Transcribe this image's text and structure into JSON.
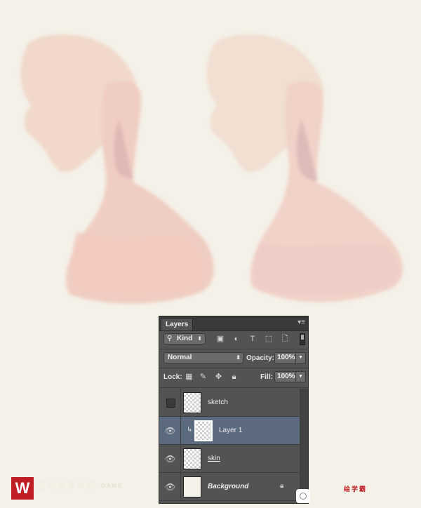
{
  "panel": {
    "tab_label": "Layers",
    "menu_icon": "panel-menu-icon",
    "filter": {
      "kind_label": "Kind"
    },
    "blend_mode": "Normal",
    "opacity_label": "Opacity:",
    "opacity_value": "100%",
    "lock_label": "Lock:",
    "fill_label": "Fill:",
    "fill_value": "100%",
    "layers": [
      {
        "name": "sketch",
        "visible": false,
        "selected": false
      },
      {
        "name": "Layer 1",
        "visible": true,
        "selected": true,
        "clipped": true
      },
      {
        "name": "skin",
        "visible": true,
        "selected": false
      },
      {
        "name": "Background",
        "visible": true,
        "selected": false,
        "locked": true
      }
    ]
  },
  "watermark": {
    "brand_cn": "王氏教育集团",
    "brand_game": "GAME",
    "brand_sub": "游戏手绘专修学院",
    "right_top": "国内最具影响力的原画",
    "right_red": "绘学霸",
    "right_bottom": "AppStore最新版本免费下载"
  },
  "colors": {
    "canvas_bg": "#f4f1e8",
    "panel_bg": "#535353",
    "selected_layer": "#5c6a80",
    "brand_red": "#c01e25"
  }
}
